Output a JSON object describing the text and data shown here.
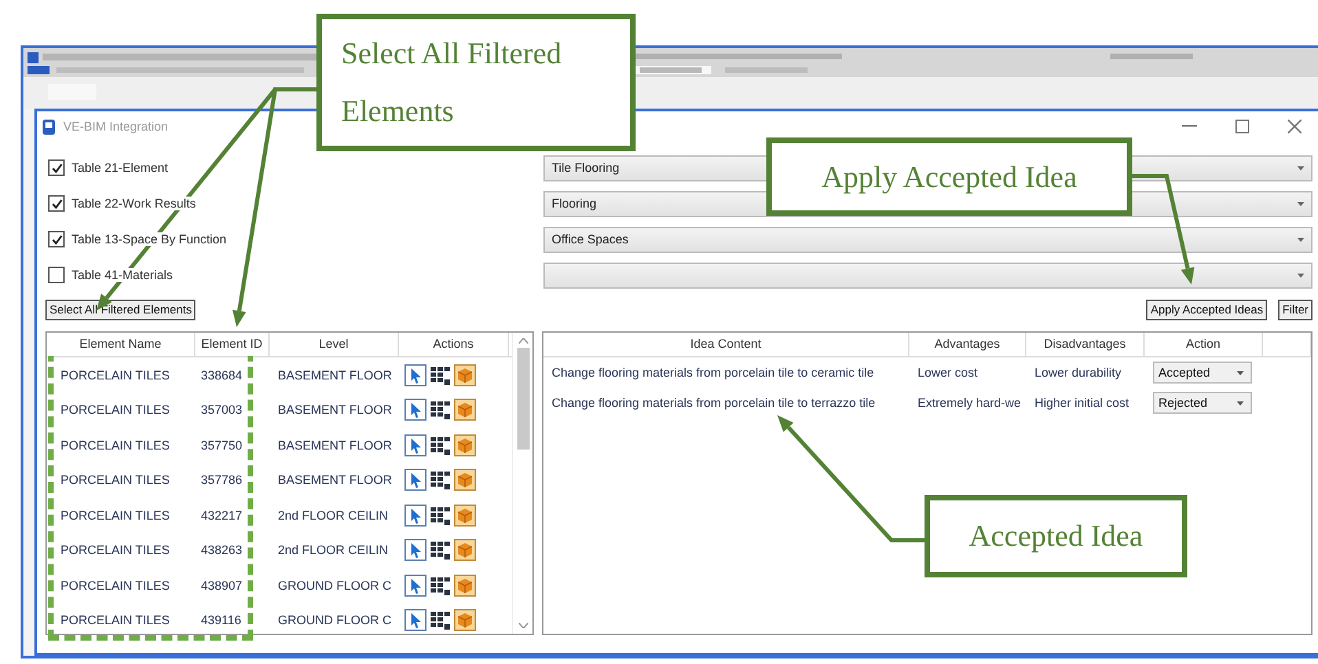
{
  "dialog": {
    "title": "VE-BIM Integration"
  },
  "filters": [
    {
      "label": "Table 21-Element",
      "checked": true,
      "value": "Tile Flooring"
    },
    {
      "label": "Table 22-Work Results",
      "checked": true,
      "value": "Flooring"
    },
    {
      "label": "Table 13-Space By Function",
      "checked": true,
      "value": "Office Spaces"
    },
    {
      "label": "Table 41-Materials",
      "checked": false
    }
  ],
  "buttons": {
    "select_all": "Select All Filtered Elements",
    "apply": "Apply Accepted Ideas",
    "filter": "Filter"
  },
  "elements_table": {
    "columns": [
      "Element Name",
      "Element ID",
      "Level",
      "Actions"
    ],
    "rows": [
      {
        "name": "PORCELAIN TILES",
        "id": "338684",
        "level": "BASEMENT FLOOR"
      },
      {
        "name": "PORCELAIN TILES",
        "id": "357003",
        "level": "BASEMENT FLOOR"
      },
      {
        "name": "PORCELAIN TILES",
        "id": "357750",
        "level": "BASEMENT FLOOR"
      },
      {
        "name": "PORCELAIN TILES",
        "id": "357786",
        "level": "BASEMENT FLOOR"
      },
      {
        "name": "PORCELAIN TILES",
        "id": "432217",
        "level": "2nd FLOOR CEILIN"
      },
      {
        "name": "PORCELAIN TILES",
        "id": "438263",
        "level": "2nd FLOOR CEILIN"
      },
      {
        "name": "PORCELAIN TILES",
        "id": "438907",
        "level": "GROUND FLOOR C"
      },
      {
        "name": "PORCELAIN TILES",
        "id": "439116",
        "level": "GROUND FLOOR C"
      }
    ]
  },
  "ideas_table": {
    "columns": [
      "Idea Content",
      "Advantages",
      "Disadvantages",
      "Action"
    ],
    "rows": [
      {
        "content": "Change flooring materials from porcelain tile to ceramic tile",
        "advantages": "Lower cost",
        "disadvantages": "Lower durability",
        "action": "Accepted"
      },
      {
        "content": "Change flooring materials from porcelain tile to terrazzo tile",
        "advantages": "Extremely hard-we",
        "disadvantages": "Higher initial cost",
        "action": "Rejected"
      }
    ]
  },
  "callouts": [
    {
      "text": "Select All Filtered Elements"
    },
    {
      "text": "Apply Accepted Idea"
    },
    {
      "text": "Accepted Idea"
    }
  ]
}
